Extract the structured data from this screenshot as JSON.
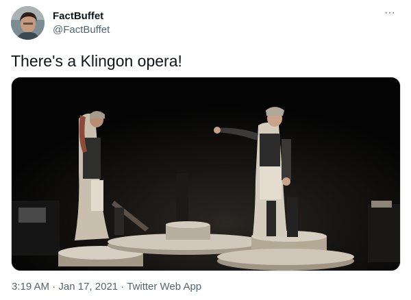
{
  "tweet": {
    "display_name": "FactBuffet",
    "handle": "@FactBuffet",
    "text": "There's a Klingon opera!",
    "more_icon": "ellipsis-icon",
    "more_glyph": "···",
    "time": "3:19 AM",
    "separator": " · ",
    "date": "Jan 17, 2021",
    "source": "Twitter Web App"
  },
  "colors": {
    "text_primary": "#0f1419",
    "text_secondary": "#536471",
    "media_background": "#050505"
  }
}
